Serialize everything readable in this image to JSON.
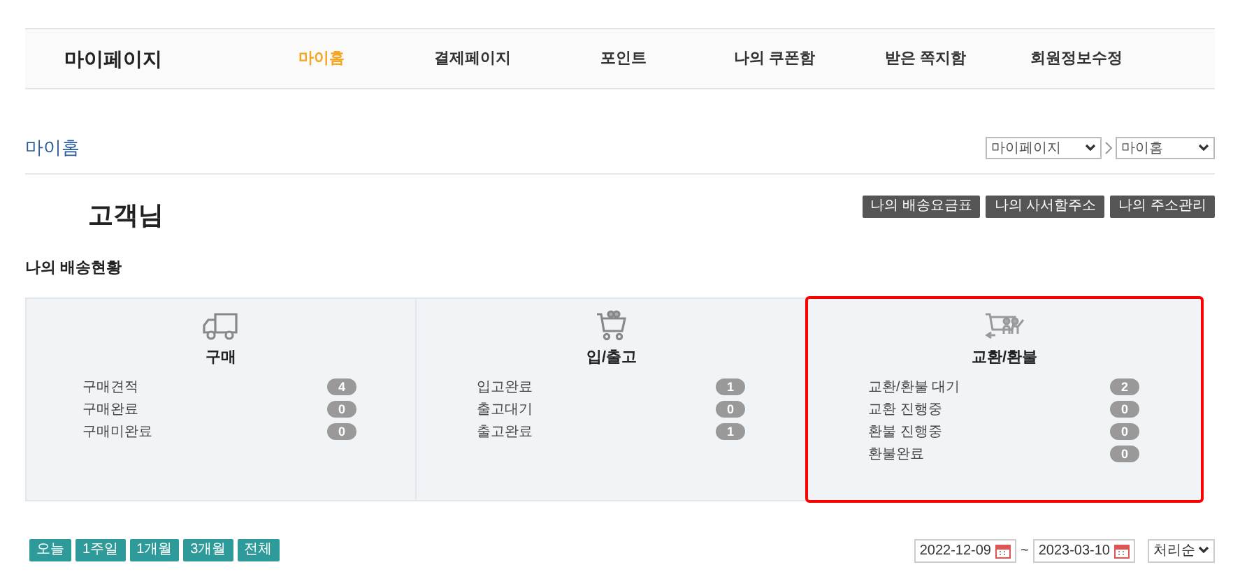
{
  "nav": {
    "title": "마이페이지",
    "items": [
      {
        "label": "마이홈",
        "selected": true
      },
      {
        "label": "결제페이지",
        "selected": false
      },
      {
        "label": "포인트",
        "selected": false
      },
      {
        "label": "나의 쿠폰함",
        "selected": false
      },
      {
        "label": "받은 쪽지함",
        "selected": false
      },
      {
        "label": "회원정보수정",
        "selected": false
      }
    ]
  },
  "page_title": "마이홈",
  "breadcrumb": [
    {
      "value": "마이페이지"
    },
    {
      "value": "마이홈"
    }
  ],
  "customer": "고객님",
  "action_buttons": [
    "나의 배송요금표",
    "나의 사서함주소",
    "나의 주소관리"
  ],
  "section_title": "나의 배송현황",
  "panels": [
    {
      "kind": "truck",
      "title": "구매",
      "highlighted": false,
      "rows": [
        {
          "label": "구매견적",
          "count": "4"
        },
        {
          "label": "구매완료",
          "count": "0"
        },
        {
          "label": "구매미완료",
          "count": "0"
        }
      ]
    },
    {
      "kind": "cart",
      "title": "입/출고",
      "highlighted": false,
      "rows": [
        {
          "label": "입고완료",
          "count": "1"
        },
        {
          "label": "출고대기",
          "count": "0"
        },
        {
          "label": "출고완료",
          "count": "1"
        }
      ]
    },
    {
      "kind": "exchange",
      "title": "교환/환불",
      "highlighted": true,
      "rows": [
        {
          "label": "교환/환불 대기",
          "count": "2"
        },
        {
          "label": "교환 진행중",
          "count": "0"
        },
        {
          "label": "환불 진행중",
          "count": "0"
        },
        {
          "label": "환불완료",
          "count": "0"
        }
      ]
    }
  ],
  "period_buttons": [
    "오늘",
    "1주일",
    "1개월",
    "3개월",
    "전체"
  ],
  "date_from": "2022-12-09",
  "date_separator": "~",
  "date_to": "2023-03-10",
  "sort": {
    "value": "처리순"
  }
}
